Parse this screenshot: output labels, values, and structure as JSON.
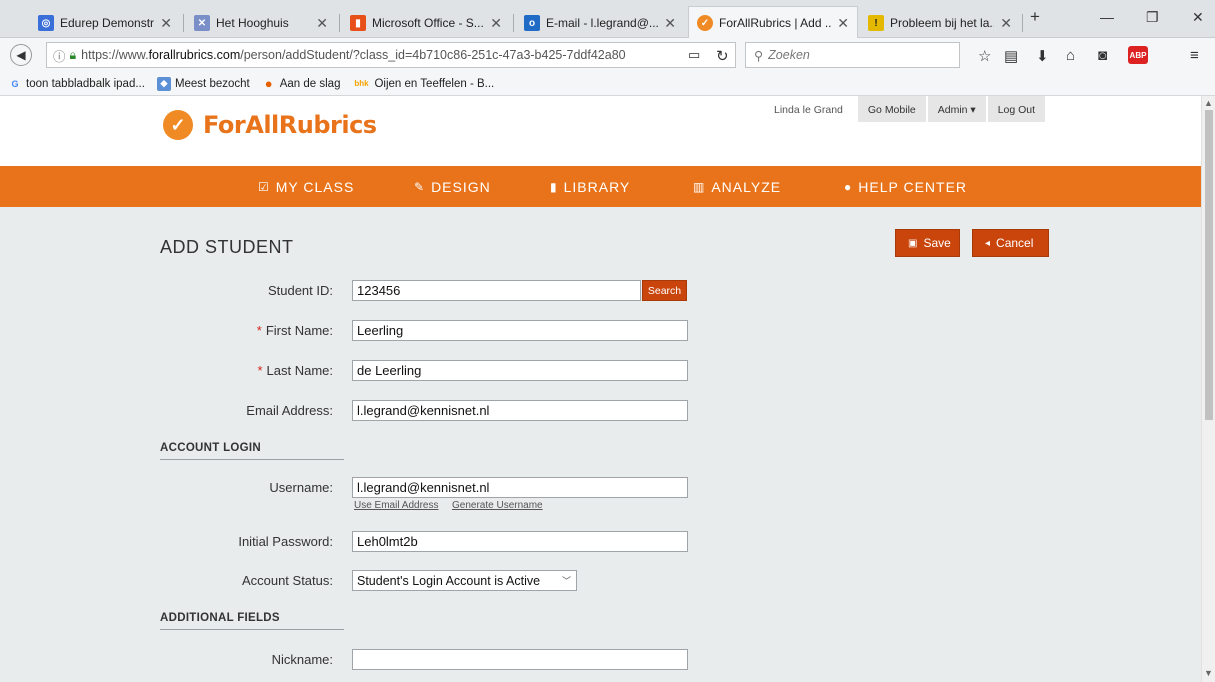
{
  "browser": {
    "tabs": [
      {
        "title": "Edurep Demonstrat...",
        "fav_color": "#3a6ed8",
        "fav_glyph": "◎"
      },
      {
        "title": "Het Hooghuis",
        "fav_color": "#7a8ec8",
        "fav_glyph": "✕"
      },
      {
        "title": "Microsoft Office - S...",
        "fav_color": "#e8501a",
        "fav_glyph": "▮"
      },
      {
        "title": "E-mail - l.legrand@...",
        "fav_color": "#1f6bc5",
        "fav_glyph": "o"
      },
      {
        "title": "ForAllRubrics | Add ...",
        "fav_color": "#f08a24",
        "fav_glyph": "✓"
      },
      {
        "title": "Probleem bij het la...",
        "fav_color": "#e5b800",
        "fav_glyph": "!"
      }
    ],
    "url_prefix": "https://www.",
    "url_domain": "forallrubrics.com",
    "url_path": "/person/addStudent/?class_id=4b710c86-251c-47a3-b425-7ddf42a80",
    "search_placeholder": "Zoeken",
    "bookmarks": [
      {
        "label": "toon tabbladbalk ipad...",
        "icon_color": "#4285f4",
        "glyph": "G"
      },
      {
        "label": "Meest bezocht",
        "icon_color": "#5b8fd6",
        "glyph": "◆"
      },
      {
        "label": "Aan de slag",
        "icon_color": "#e66000",
        "glyph": "●"
      },
      {
        "label": "Oijen en Teeffelen - B...",
        "icon_color": "#f6c300",
        "glyph": "bhk"
      }
    ]
  },
  "header": {
    "brand": "ForAllRubrics",
    "user_name": "Linda le Grand",
    "go_mobile": "Go Mobile",
    "admin": "Admin ▾",
    "log_out": "Log Out"
  },
  "menu": [
    {
      "label": "MY CLASS",
      "icon": "☑"
    },
    {
      "label": "DESIGN",
      "icon": "✎"
    },
    {
      "label": "LIBRARY",
      "icon": "▮"
    },
    {
      "label": "ANALYZE",
      "icon": "▥"
    },
    {
      "label": "HELP CENTER",
      "icon": "●"
    }
  ],
  "page": {
    "title": "ADD STUDENT",
    "save": "Save",
    "cancel": "Cancel"
  },
  "form": {
    "student_id_label": "Student ID:",
    "student_id_value": "123456",
    "search_button": "Search",
    "first_name_label": "First Name:",
    "first_name_value": "Leerling",
    "last_name_label": "Last Name:",
    "last_name_value": "de Leerling",
    "email_label": "Email Address:",
    "email_value": "l.legrand@kennisnet.nl",
    "account_login_heading": "ACCOUNT LOGIN",
    "username_label": "Username:",
    "username_value": "l.legrand@kennisnet.nl",
    "use_email_link": "Use Email Address",
    "generate_username_link": "Generate Username",
    "password_label": "Initial Password:",
    "password_value": "Leh0lmt2b",
    "status_label": "Account Status:",
    "status_value": "Student's Login Account is Active",
    "additional_heading": "ADDITIONAL FIELDS",
    "nickname_label": "Nickname:",
    "nickname_value": ""
  }
}
